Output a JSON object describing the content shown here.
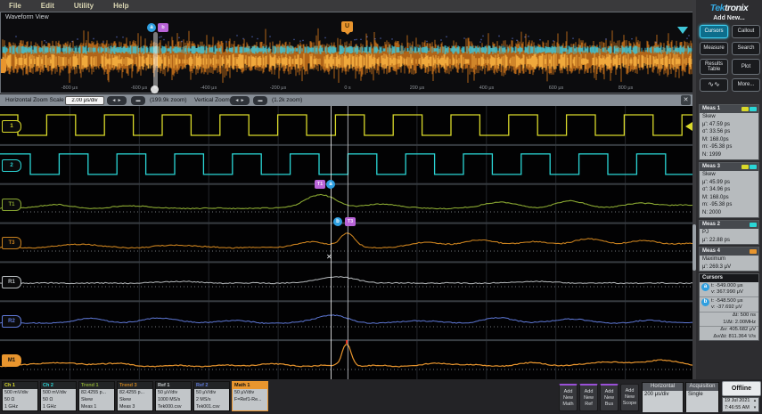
{
  "menu": {
    "items": [
      "File",
      "Edit",
      "Utility",
      "Help"
    ]
  },
  "overview": {
    "title": "Waveform View",
    "ticks": [
      "-800 μs",
      "-600 μs",
      "-400 μs",
      "-200 μs",
      "0 s",
      "200 μs",
      "400 μs",
      "600 μs",
      "800 μs"
    ],
    "cursor_a": "a",
    "cursor_b": "b",
    "trigger_label": "U"
  },
  "zoom_toolbar": {
    "h_label": "Horizontal Zoom Scale",
    "h_scale": "2.00 μs/div",
    "h_zoom_pct": "(199.9k zoom)",
    "v_label": "Vertical Zoom",
    "v_zoom_pct": "(1.2k zoom)",
    "zoom_in_glyph": "◄ ►",
    "zoom_out_glyph": "▬",
    "close_glyph": "✕"
  },
  "main_view": {
    "channels": [
      {
        "handle": "1",
        "color": "#d9d92a",
        "type": "square"
      },
      {
        "handle": "2",
        "color": "#2bd6d6",
        "type": "square"
      },
      {
        "handle": "T1",
        "color": "#8aa832",
        "type": "trend"
      },
      {
        "handle": "T3",
        "color": "#c8801e",
        "type": "trend"
      },
      {
        "handle": "R1",
        "color": "#b9bdc0",
        "type": "trend"
      },
      {
        "handle": "R2",
        "color": "#5f79d8",
        "type": "trend"
      },
      {
        "handle": "M1",
        "color": "#e8952e",
        "type": "math"
      }
    ],
    "cursor_a": "a",
    "cursor_b": "b",
    "flag_t1": "T1",
    "flag_t3": "T3",
    "x_marker_glyph": "✕"
  },
  "sidebar": {
    "brand": "Tektronix",
    "add_new_label": "Add New...",
    "buttons": [
      "Cursors",
      "Callout",
      "Measure",
      "Search",
      "Results Table",
      "Plot",
      "More..."
    ],
    "icon_button_glyph": "∿∿",
    "meas_panels": [
      {
        "title": "Meas 1",
        "chips": [
          "#d9d92a",
          "#2bd6d6"
        ],
        "lines": [
          "Skew",
          "μ': 47.59 ps",
          "σ': 33.56 ps",
          "M: 168.0ps",
          "m: -95.38 ps",
          "N: 1999"
        ]
      },
      {
        "title": "Meas 3",
        "chips": [
          "#d9d92a",
          "#2bd6d6"
        ],
        "lines": [
          "Skew",
          "μ': 45.99 ps",
          "σ': 34.96 ps",
          "M: 168.0ps",
          "m: -95.38 ps",
          "N: 2000"
        ]
      },
      {
        "title": "Meas 2",
        "chips": [
          "#2bd6d6"
        ],
        "lines": [
          "PJ",
          "μ': 22.88 ps"
        ]
      },
      {
        "title": "Meas 4",
        "chips": [
          "#e8952e"
        ],
        "lines": [
          "Maximum",
          "μ': 269.3 μV"
        ]
      }
    ],
    "cursors_panel": {
      "title": "Cursors",
      "rows": [
        {
          "icon": "a",
          "lines": [
            "t: -549.000 μs",
            "v: 367.990 μV"
          ]
        },
        {
          "icon": "b",
          "lines": [
            "t: -548.500 μs",
            "v: -37.692 μV"
          ]
        }
      ],
      "deltas": [
        "Δt: 500 ns",
        "1/Δt: 2.00MHz",
        "Δv: 405.682 μV",
        "Δv/Δt: 811.364 V/s"
      ]
    }
  },
  "bottom": {
    "badges": [
      {
        "title": "Ch 1",
        "color": "#d9d92a",
        "lines": [
          "500 mV/div",
          "50 Ω",
          "1 GHz"
        ]
      },
      {
        "title": "Ch 2",
        "color": "#2bd6d6",
        "lines": [
          "500 mV/div",
          "50 Ω",
          "1 GHz"
        ]
      },
      {
        "title": "Trend 1",
        "color": "#8aa832",
        "lines": [
          "82.4255 p...",
          "Skew",
          "Meas 1"
        ]
      },
      {
        "title": "Trend 3",
        "color": "#c8801e",
        "lines": [
          "82.4255 p...",
          "Skew",
          "Meas 3"
        ]
      },
      {
        "title": "Ref 1",
        "color": "#c8ccce",
        "lines": [
          "50 μV/div",
          "1000 MS/s",
          "Tek000.csv"
        ]
      },
      {
        "title": "Ref 2",
        "color": "#5f79d8",
        "lines": [
          "50 μV/div",
          "2 MS/s",
          "Tek001.csv"
        ]
      },
      {
        "title": "Math 1",
        "color": "#e8952e",
        "lines": [
          "50 μV/div",
          "F=Ref1-Re...",
          ""
        ],
        "selected": true
      }
    ],
    "add_buttons": [
      [
        "Add",
        "New",
        "Math"
      ],
      [
        "Add",
        "New",
        "Ref"
      ],
      [
        "Add",
        "New",
        "Bus"
      ],
      [
        "Add",
        "New",
        "Scope"
      ]
    ],
    "horizontal": {
      "title": "Horizontal",
      "value": "200 μs/div"
    },
    "acquisition": {
      "title": "Acquisition",
      "value": "Single"
    },
    "offline_label": "Offline",
    "datetime": [
      "19 Jul 2021",
      "7:46:55 AM"
    ],
    "spin_up": "▴",
    "spin_down": "▾"
  }
}
